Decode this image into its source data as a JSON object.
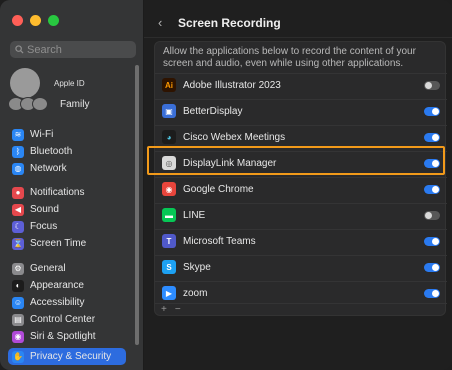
{
  "sidebar": {
    "search_placeholder": "Search",
    "apple_id_label": "Apple ID",
    "family_label": "Family",
    "items": [
      {
        "label": "Wi-Fi",
        "icon": "wifi-icon",
        "color": "#2a86f4",
        "glyph": "≋"
      },
      {
        "label": "Bluetooth",
        "icon": "bluetooth-icon",
        "color": "#2a86f4",
        "glyph": "ᛒ"
      },
      {
        "label": "Network",
        "icon": "network-icon",
        "color": "#2a86f4",
        "glyph": "◍"
      },
      {
        "label": "Notifications",
        "icon": "bell-icon",
        "color": "#e5484d",
        "glyph": "●"
      },
      {
        "label": "Sound",
        "icon": "speaker-icon",
        "color": "#e5484d",
        "glyph": "◀"
      },
      {
        "label": "Focus",
        "icon": "moon-icon",
        "color": "#5d5fd6",
        "glyph": "☾"
      },
      {
        "label": "Screen Time",
        "icon": "hourglass-icon",
        "color": "#5d5fd6",
        "glyph": "⌛"
      },
      {
        "label": "General",
        "icon": "gear-icon",
        "color": "#8a8a8d",
        "glyph": "⚙"
      },
      {
        "label": "Appearance",
        "icon": "appearance-icon",
        "color": "#1c1c1c",
        "glyph": "◐"
      },
      {
        "label": "Accessibility",
        "icon": "accessibility-icon",
        "color": "#2a86f4",
        "glyph": "☺"
      },
      {
        "label": "Control Center",
        "icon": "control-center-icon",
        "color": "#8a8a8d",
        "glyph": "▤"
      },
      {
        "label": "Siri & Spotlight",
        "icon": "siri-icon",
        "color": "#b04ad8",
        "glyph": "◉"
      },
      {
        "label": "Privacy & Security",
        "icon": "hand-icon",
        "color": "#2a86f4",
        "glyph": "✋"
      }
    ]
  },
  "main": {
    "title": "Screen Recording",
    "back_icon": "chevron-left-icon",
    "description": "Allow the applications below to record the content of your screen and audio, even while using other applications.",
    "apps": [
      {
        "name": "Adobe Illustrator 2023",
        "enabled": false,
        "icon": "illustrator-icon",
        "color": "#2e1300",
        "glyph": "Ai",
        "glyph_color": "#ff9a00"
      },
      {
        "name": "BetterDisplay",
        "enabled": true,
        "icon": "betterdisplay-icon",
        "color": "#3a6fd8",
        "glyph": "▣",
        "glyph_color": "#ffffff"
      },
      {
        "name": "Cisco Webex Meetings",
        "enabled": true,
        "icon": "webex-icon",
        "color": "#1c1c1c",
        "glyph": "◕",
        "glyph_color": "#4ec4e0"
      },
      {
        "name": "DisplayLink Manager",
        "enabled": true,
        "icon": "displaylink-icon",
        "color": "#d9d9d9",
        "glyph": "◎",
        "glyph_color": "#555555"
      },
      {
        "name": "Google Chrome",
        "enabled": true,
        "icon": "chrome-icon",
        "color": "#e8453c",
        "glyph": "◉",
        "glyph_color": "#ffffff"
      },
      {
        "name": "LINE",
        "enabled": false,
        "icon": "line-icon",
        "color": "#06c755",
        "glyph": "▬",
        "glyph_color": "#ffffff"
      },
      {
        "name": "Microsoft Teams",
        "enabled": true,
        "icon": "teams-icon",
        "color": "#5059c9",
        "glyph": "T",
        "glyph_color": "#ffffff"
      },
      {
        "name": "Skype",
        "enabled": true,
        "icon": "skype-icon",
        "color": "#1da1f2",
        "glyph": "S",
        "glyph_color": "#ffffff"
      },
      {
        "name": "zoom",
        "enabled": true,
        "icon": "zoom-icon",
        "color": "#2d8cff",
        "glyph": "▶",
        "glyph_color": "#ffffff"
      }
    ],
    "add_label": "+",
    "remove_label": "−"
  },
  "colors": {
    "accent": "#2a7af0",
    "highlight": "#f29a1a"
  }
}
